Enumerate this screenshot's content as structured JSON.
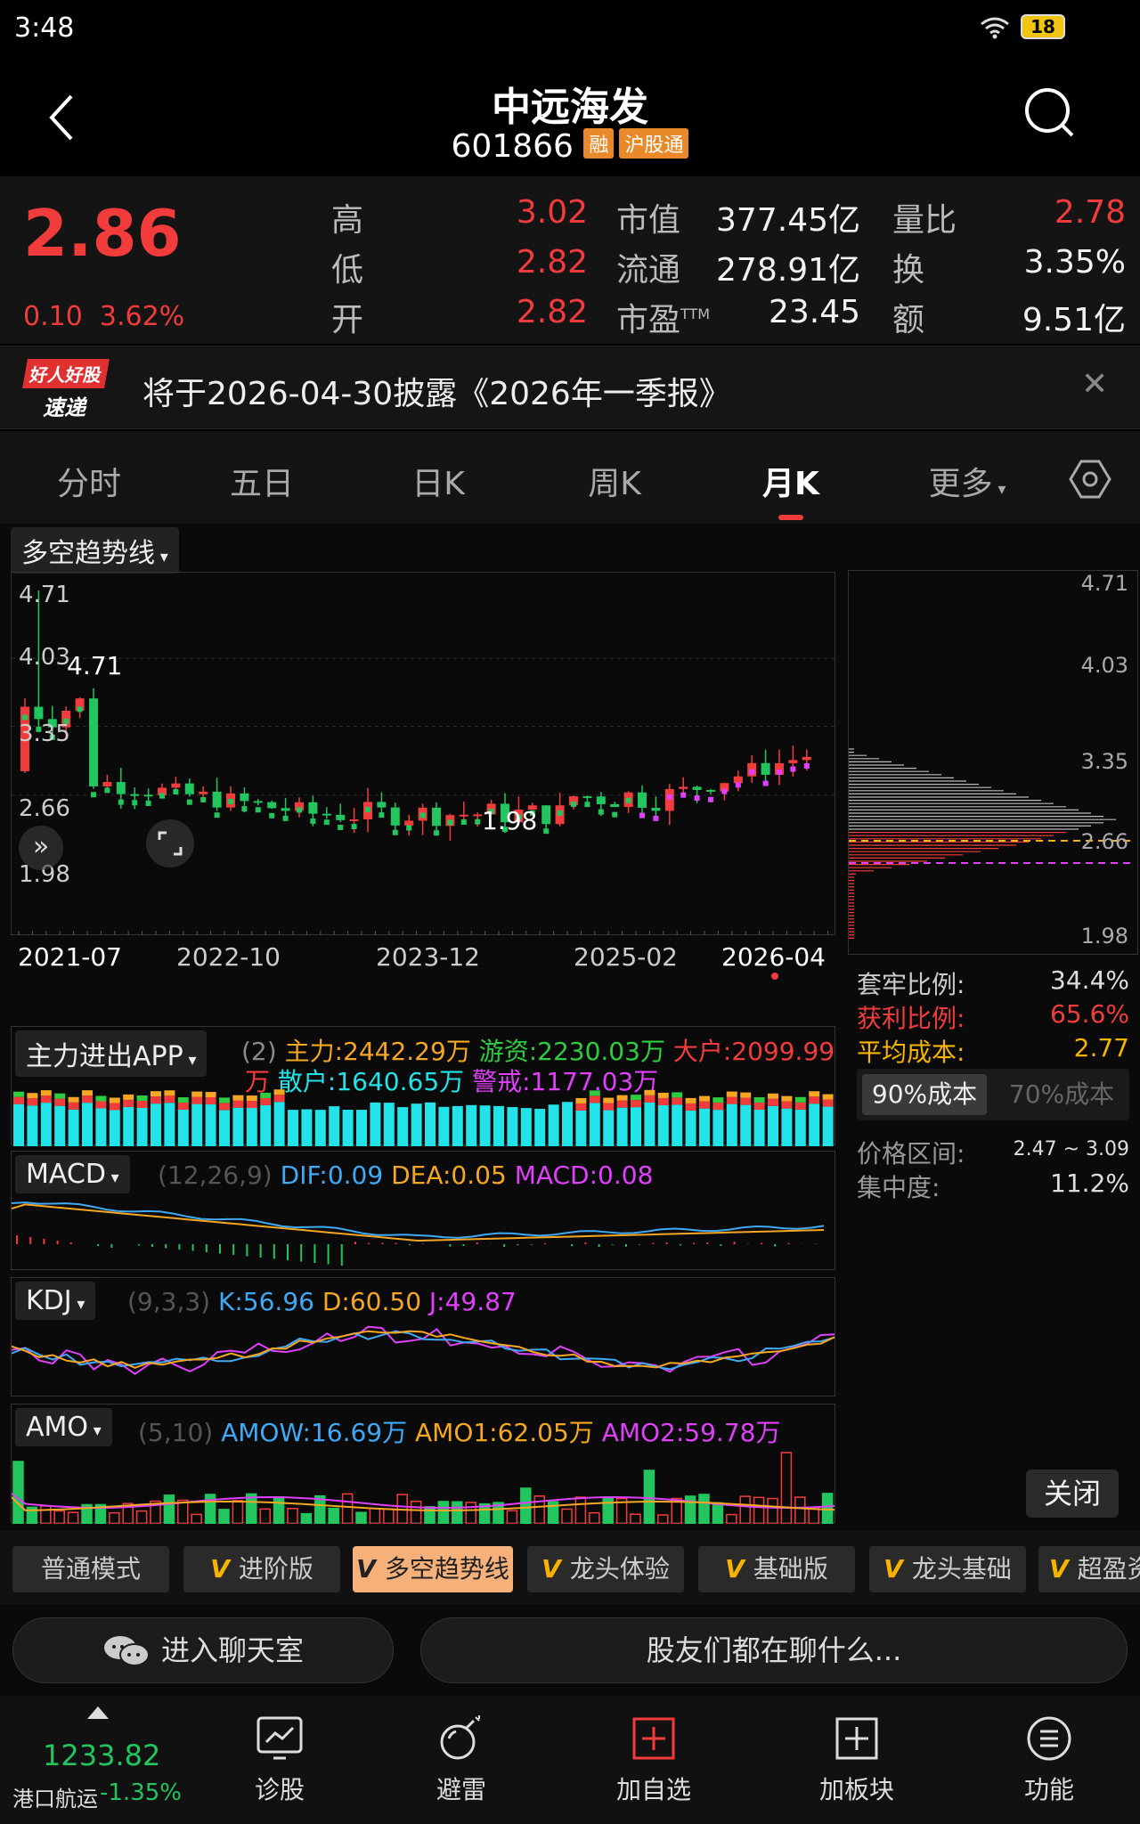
{
  "status": {
    "time": "3:48",
    "battery": "18"
  },
  "header": {
    "name": "中远海发",
    "code": "601866",
    "tag_rong": "融",
    "tag_hgt": "沪股通"
  },
  "quote": {
    "price": "2.86",
    "change": "0.10",
    "change_pct": "3.62%",
    "rows": [
      {
        "l1": "高",
        "v1": "3.02",
        "l2": "市值",
        "v2": "377.45亿",
        "l3": "量比",
        "v3": "2.78"
      },
      {
        "l1": "低",
        "v1": "2.82",
        "l2": "流通",
        "v2": "278.91亿",
        "l3": "换",
        "v3": "3.35%"
      },
      {
        "l1": "开",
        "v1": "2.82",
        "l2": "市盈",
        "v2": "23.45",
        "l3": "额",
        "v3": "9.51亿"
      }
    ],
    "ttm_sup": "TTM"
  },
  "notice": {
    "logo_top": "好人好股",
    "logo_bottom": "速递",
    "text": "将于2026-04-30披露《2026年一季报》"
  },
  "period_tabs": [
    "分时",
    "五日",
    "日K",
    "周K",
    "月K",
    "更多"
  ],
  "main_chart": {
    "selector": "多空趋势线",
    "y_labels": [
      "4.71",
      "4.03",
      "3.35",
      "2.66",
      "1.98"
    ],
    "high_mark": "4.71",
    "low_mark": "1.98",
    "x_labels": [
      "2021-07",
      "2022-10",
      "2023-12",
      "2025-02",
      "2026-04"
    ]
  },
  "chip_panel": {
    "y_labels": [
      "4.71",
      "4.03",
      "3.35",
      "2.66",
      "1.98"
    ],
    "trapped_label": "套牢比例:",
    "trapped": "34.4%",
    "profit_label": "获利比例:",
    "profit": "65.6%",
    "avg_label": "平均成本:",
    "avg": "2.77",
    "tab_90": "90%成本",
    "tab_70": "70%成本",
    "range_label": "价格区间:",
    "range": "2.47 ~ 3.09",
    "conc_label": "集中度:",
    "conc": "11.2%",
    "close": "关闭"
  },
  "fund_flow": {
    "selector": "主力进出APP",
    "param": "(2)",
    "main": "主力:2442.29万",
    "hot": "游资:2230.03万",
    "big": "大户:2099.99",
    "big_unit": "万",
    "retail": "散户:1640.65万",
    "alert": "警戒:1177.03万"
  },
  "macd": {
    "selector": "MACD",
    "param": "(12,26,9)",
    "dif": "DIF:0.09",
    "dea": "DEA:0.05",
    "macd": "MACD:0.08"
  },
  "kdj": {
    "selector": "KDJ",
    "param": "(9,3,3)",
    "k": "K:56.96",
    "d": "D:60.50",
    "j": "J:49.87"
  },
  "amo": {
    "selector": "AMO",
    "param": "(5,10)",
    "amow": "AMOW:16.69万",
    "amo1": "AMO1:62.05万",
    "amo2": "AMO2:59.78万"
  },
  "mode_tabs": [
    "普通模式",
    "进阶版",
    "多空趋势线",
    "龙头体验",
    "基础版",
    "龙头基础",
    "超盈资"
  ],
  "chat": {
    "enter": "进入聊天室",
    "prompt": "股友们都在聊什么..."
  },
  "bottom_nav": {
    "index_value": "1233.82",
    "index_name": "港口航运",
    "index_change": "-1.35%",
    "items": [
      "诊股",
      "避雷",
      "加自选",
      "加板块",
      "功能"
    ]
  },
  "colors": {
    "up": "#f23c3c",
    "down": "#22c55e",
    "accent": "#f6b07a"
  }
}
